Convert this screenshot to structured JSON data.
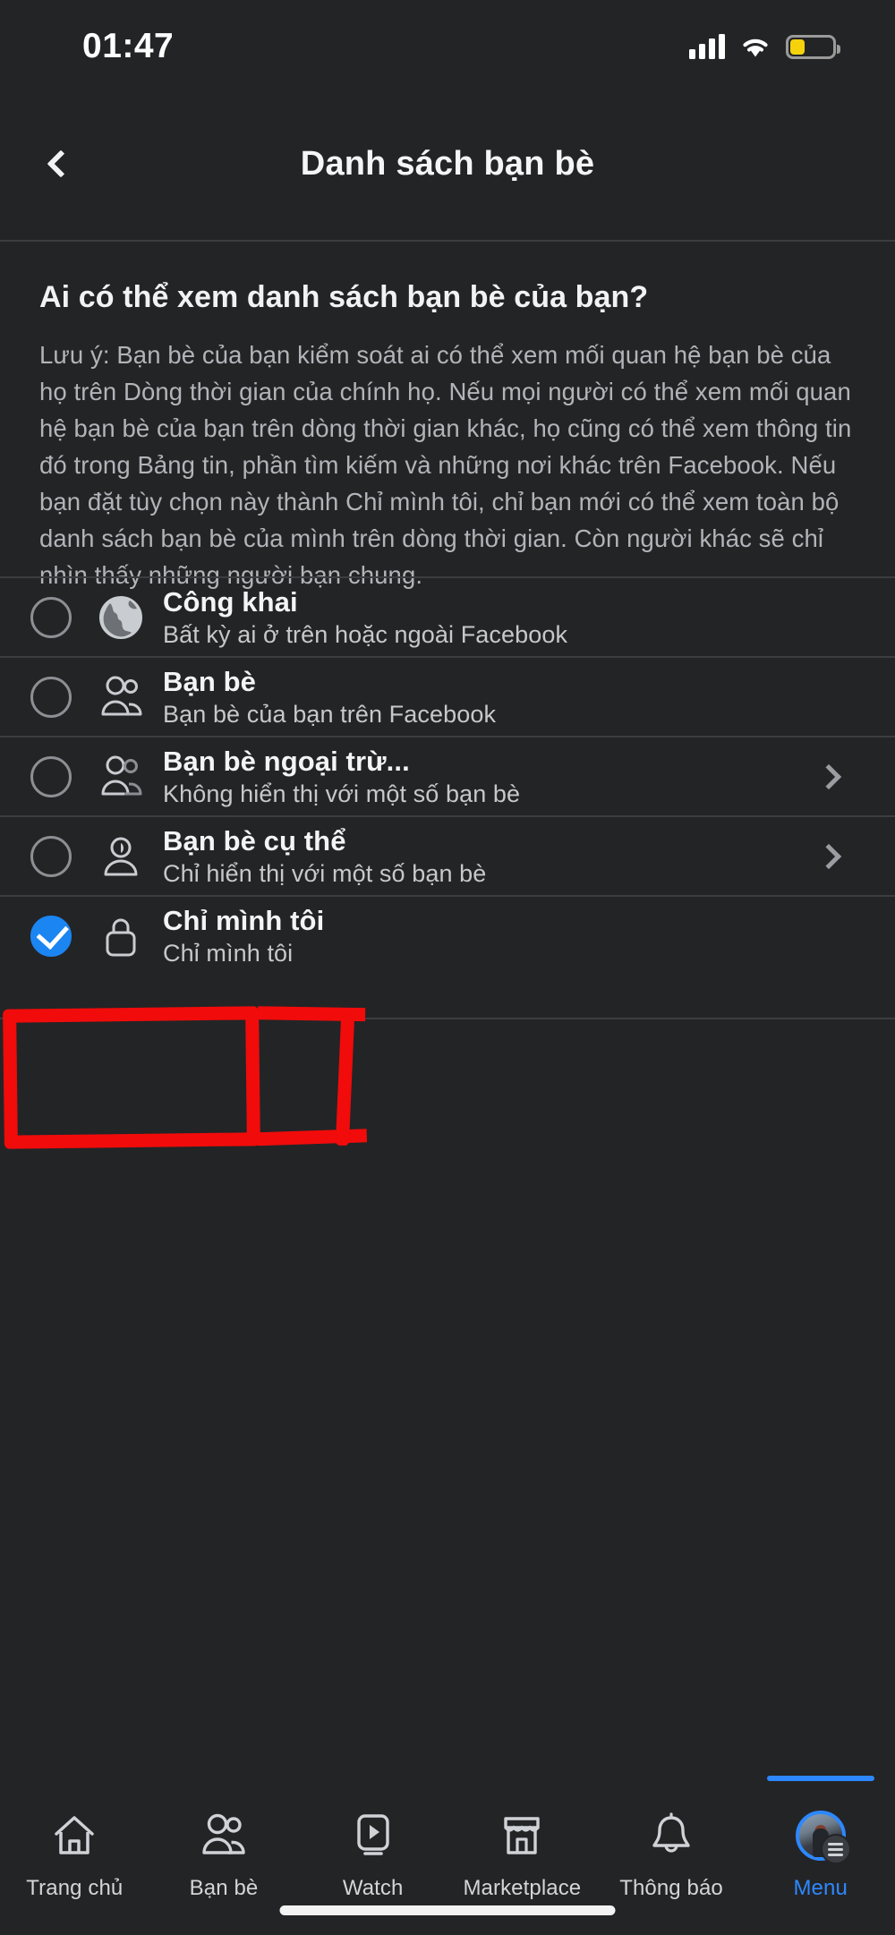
{
  "status_bar": {
    "time": "01:47",
    "signal_icon": "cellular-bars-icon",
    "wifi_icon": "wifi-icon",
    "battery_icon": "battery-low-icon",
    "battery_color": "#f5d20c"
  },
  "header": {
    "back_icon": "chevron-left-icon",
    "title": "Danh sách bạn bè"
  },
  "intro": {
    "heading": "Ai có thể xem danh sách bạn bè của bạn?",
    "description": "Lưu ý: Bạn bè của bạn kiểm soát ai có thể xem mối quan hệ bạn bè của họ trên Dòng thời gian của chính họ. Nếu mọi người có thể xem mối quan hệ bạn bè của bạn trên dòng thời gian khác, họ cũng có thể xem thông tin đó trong Bảng tin, phần tìm kiếm và những nơi khác trên Facebook. Nếu bạn đặt tùy chọn này thành Chỉ mình tôi, chỉ bạn mới có thể xem toàn bộ danh sách bạn bè của mình trên dòng thời gian. Còn người khác sẽ chỉ nhìn thấy những người bạn chung."
  },
  "options": [
    {
      "title": "Công khai",
      "subtitle": "Bất kỳ ai ở trên hoặc ngoài Facebook",
      "icon": "globe-icon",
      "selected": false,
      "has_chevron": false
    },
    {
      "title": "Bạn bè",
      "subtitle": "Bạn bè của bạn trên Facebook",
      "icon": "friends-icon",
      "selected": false,
      "has_chevron": false
    },
    {
      "title": "Bạn bè ngoại trừ...",
      "subtitle": "Không hiển thị với một số bạn bè",
      "icon": "friends-except-icon",
      "selected": false,
      "has_chevron": true
    },
    {
      "title": "Bạn bè cụ thể",
      "subtitle": "Chỉ hiển thị với một số bạn bè",
      "icon": "specific-friends-icon",
      "selected": false,
      "has_chevron": true
    },
    {
      "title": "Chỉ mình tôi",
      "subtitle": "Chỉ mình tôi",
      "icon": "lock-icon",
      "selected": true,
      "has_chevron": false
    }
  ],
  "annotation": {
    "shape": "red-rectangle-highlight",
    "color": "#f10b0b",
    "targets_option": "Chỉ mình tôi"
  },
  "selected_value": "Chỉ mình tôi",
  "accent_color": "#2d88ff",
  "bottom_nav": {
    "active": "Menu",
    "items": [
      {
        "label": "Trang chủ",
        "icon": "home-icon"
      },
      {
        "label": "Bạn bè",
        "icon": "friends-icon"
      },
      {
        "label": "Watch",
        "icon": "video-play-icon"
      },
      {
        "label": "Marketplace",
        "icon": "store-icon"
      },
      {
        "label": "Thông báo",
        "icon": "bell-icon"
      },
      {
        "label": "Menu",
        "icon": "avatar-menu-icon"
      }
    ]
  }
}
